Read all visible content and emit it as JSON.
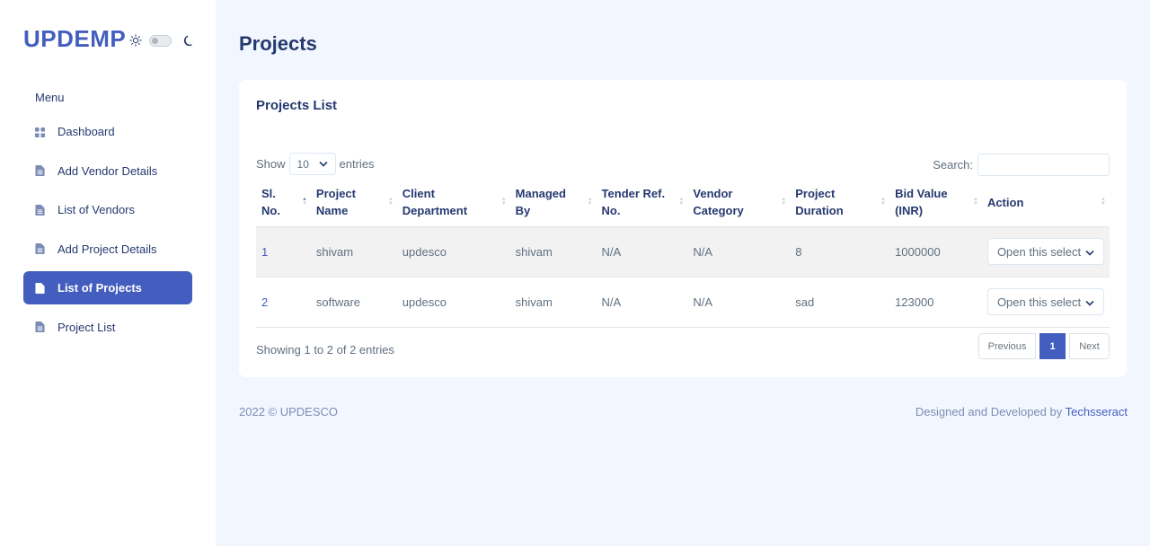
{
  "sidebar": {
    "logo": "UPDEMP",
    "menu_title": "Menu",
    "items": [
      {
        "label": "Dashboard",
        "icon": "grid-icon"
      },
      {
        "label": "Add Vendor Details",
        "icon": "document-icon"
      },
      {
        "label": "List of Vendors",
        "icon": "document-icon"
      },
      {
        "label": "Add Project Details",
        "icon": "document-icon"
      },
      {
        "label": "List of Projects",
        "icon": "document-icon",
        "active": true
      },
      {
        "label": "Project List",
        "icon": "document-icon"
      }
    ]
  },
  "page": {
    "title": "Projects"
  },
  "card": {
    "title": "Projects List",
    "length": {
      "show": "Show",
      "value": "10",
      "entries": "entries"
    },
    "search": {
      "label": "Search:",
      "value": ""
    },
    "columns": [
      "Sl.\nNo.",
      "Project\nName",
      "Client\nDepartment",
      "Managed\nBy",
      "Tender Ref.\nNo.",
      "Vendor\nCategory",
      "Project\nDuration",
      "Bid Value\n(INR)",
      "Action"
    ],
    "rows": [
      {
        "sl": "1",
        "name": "shivam",
        "dept": "updesco",
        "managed": "shivam",
        "tender": "N/A",
        "category": "N/A",
        "duration": "8",
        "bid": "1000000",
        "action": "Open this select"
      },
      {
        "sl": "2",
        "name": "software",
        "dept": "updesco",
        "managed": "shivam",
        "tender": "N/A",
        "category": "N/A",
        "duration": "sad",
        "bid": "123000",
        "action": "Open this select"
      }
    ],
    "info": "Showing 1 to 2 of 2 entries",
    "pager": {
      "prev": "Previous",
      "current": "1",
      "next": "Next"
    }
  },
  "footer": {
    "left": "2022 © UPDESCO",
    "right_prefix": "Designed and Developed by",
    "right_link": "Techsseract"
  },
  "colors": {
    "accent": "#435ebe",
    "text": "#25396f",
    "muted": "#607080",
    "background": "#f2f7ff"
  }
}
